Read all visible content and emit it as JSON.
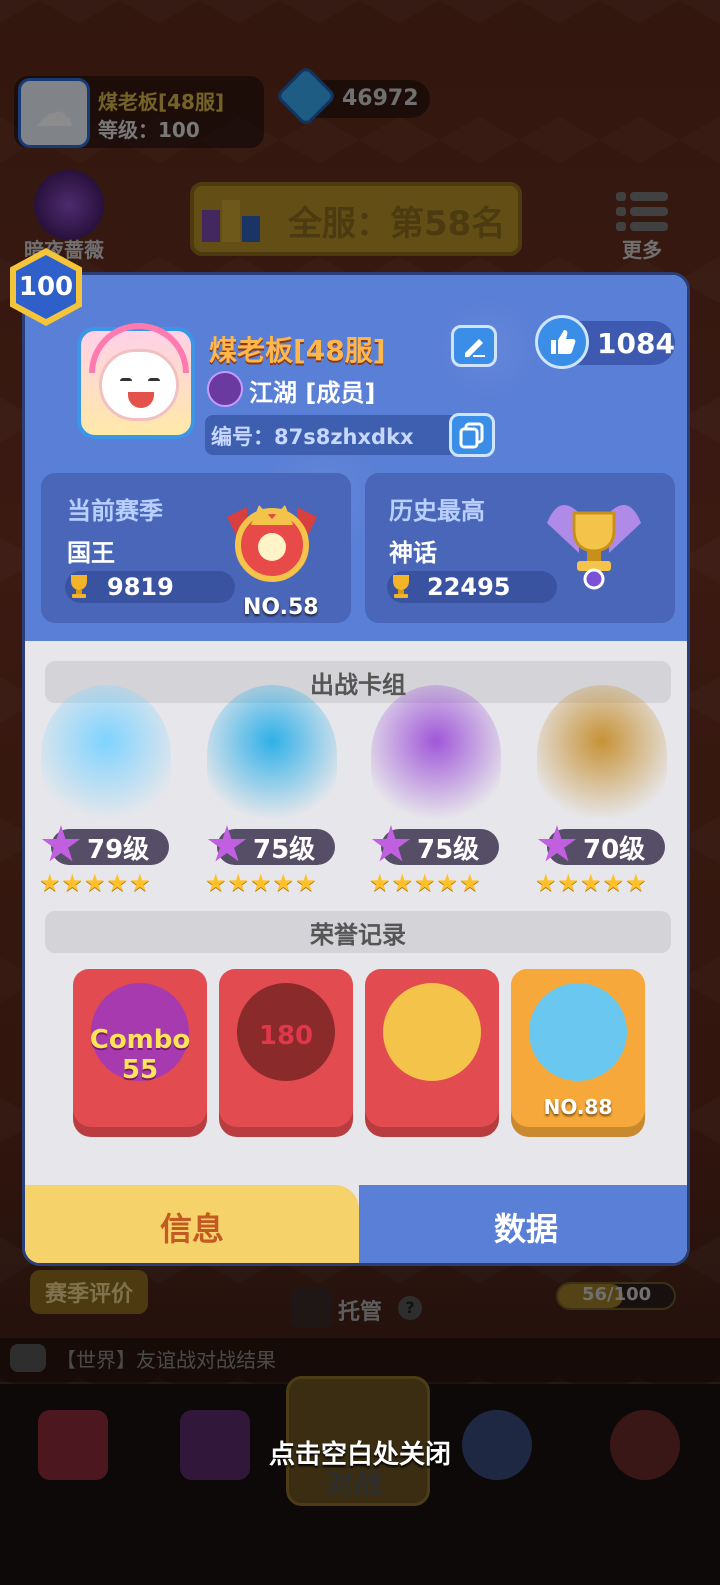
{
  "background": {
    "top_profile": {
      "name": "煤老板[48服]",
      "level": "等级：100"
    },
    "gems": {
      "icon": "gem-plus-icon",
      "count": "46972"
    },
    "left_character": {
      "name": "暗夜蔷薇"
    },
    "rank_banner": {
      "text": "全服：第58名"
    },
    "more": {
      "label": "更多"
    },
    "season_eval": {
      "label": "赛季评价"
    },
    "auto": {
      "label": "托管",
      "help": "?"
    },
    "pass": {
      "progress_text": "56/100",
      "progress_value": 0.56
    },
    "chat": {
      "text": "【世界】友谊战对战结果"
    },
    "battle": {
      "label": "对战"
    }
  },
  "close_hint": "点击空白处关闭",
  "modal": {
    "level_badge": "100",
    "player": {
      "name": "煤老板[48服]",
      "guild": "江湖 [成员]",
      "id_text": "编号：87s8zhxdkx",
      "likes": "1084"
    },
    "current_season": {
      "title": "当前赛季",
      "tier": "国王",
      "trophies": "9819",
      "rank": "NO.58"
    },
    "history_best": {
      "title": "历史最高",
      "tier": "神话",
      "trophies": "22495"
    },
    "deck_title": "出战卡组",
    "deck": [
      {
        "level": "79级",
        "stars": "★★★★★",
        "color": "#7fd3ff"
      },
      {
        "level": "75级",
        "stars": "★★★★★",
        "color": "#2fb0e8"
      },
      {
        "level": "75级",
        "stars": "★★★★★",
        "color": "#a057d8"
      },
      {
        "level": "70级",
        "stars": "★★★★★",
        "color": "#c79236"
      }
    ],
    "honor_title": "荣誉记录",
    "honors": [
      {
        "line1": "Combo",
        "line2": "55"
      },
      {
        "line1": "180"
      },
      {
        "line1": ""
      },
      {
        "rank": "NO.88"
      }
    ],
    "tabs": {
      "info": "信息",
      "data": "数据"
    }
  }
}
